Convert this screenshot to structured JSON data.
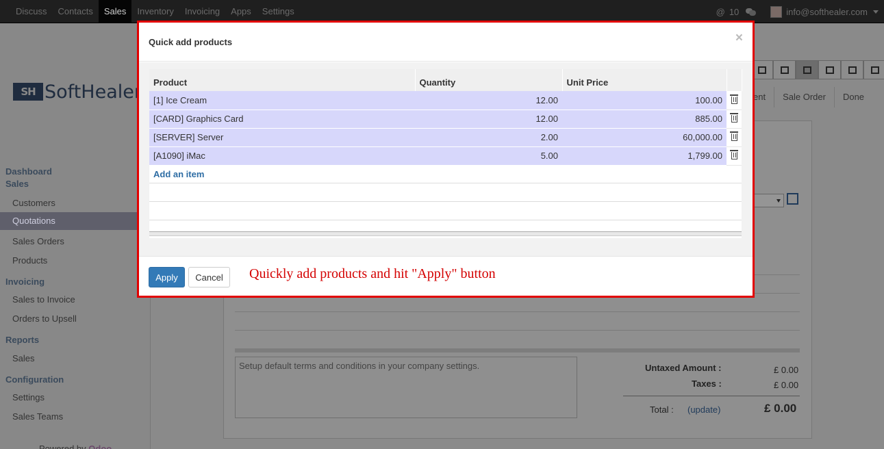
{
  "topbar": {
    "menu": [
      "Discuss",
      "Contacts",
      "Sales",
      "Inventory",
      "Invoicing",
      "Apps",
      "Settings"
    ],
    "active": "Sales",
    "notif_count": "10",
    "user_email": "info@softhealer.com"
  },
  "logo": {
    "mark": "SH",
    "text": "SoftHealer"
  },
  "sidebar": {
    "head_dashboard": "Dashboard",
    "head_sales": "Sales",
    "customers": "Customers",
    "quotations": "Quotations",
    "sales_orders": "Sales Orders",
    "products": "Products",
    "head_invoicing": "Invoicing",
    "sales_to_invoice": "Sales to Invoice",
    "orders_to_upsell": "Orders to Upsell",
    "head_reports": "Reports",
    "reports_sales": "Sales",
    "head_configuration": "Configuration",
    "settings": "Settings",
    "sales_teams": "Sales Teams",
    "powered_prefix": "Powered by",
    "powered_brand": "Odoo"
  },
  "background": {
    "crumb_1": "ent",
    "crumb_2": "Sale Order",
    "crumb_3": "Done",
    "terms_placeholder": "Setup default terms and conditions in your company settings.",
    "untaxed_label": "Untaxed Amount :",
    "untaxed_value": "£ 0.00",
    "taxes_label": "Taxes :",
    "taxes_value": "£ 0.00",
    "total_label": "Total :",
    "update_link": "(update)",
    "total_value": "£ 0.00"
  },
  "modal": {
    "title": "Quick add products",
    "close": "×",
    "columns": {
      "product": "Product",
      "quantity": "Quantity",
      "unit_price": "Unit Price"
    },
    "rows": [
      {
        "product": "[1] Ice Cream",
        "quantity": "12.00",
        "unit_price": "100.00"
      },
      {
        "product": "[CARD] Graphics Card",
        "quantity": "12.00",
        "unit_price": "885.00"
      },
      {
        "product": "[SERVER] Server",
        "quantity": "2.00",
        "unit_price": "60,000.00"
      },
      {
        "product": "[A1090] iMac",
        "quantity": "5.00",
        "unit_price": "1,799.00"
      }
    ],
    "add_item": "Add an item",
    "apply": "Apply",
    "cancel": "Cancel",
    "note": "Quickly add products and hit \"Apply\" button"
  }
}
